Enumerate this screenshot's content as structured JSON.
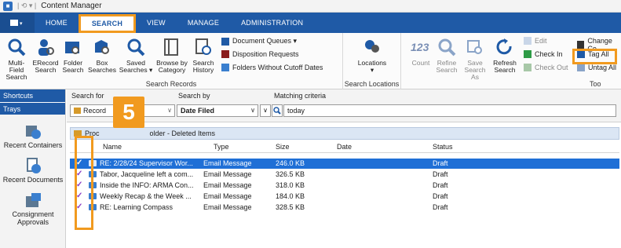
{
  "title": "Content Manager",
  "file_tab_label": "▾",
  "tabs": [
    "HOME",
    "SEARCH",
    "VIEW",
    "MANAGE",
    "ADMINISTRATION"
  ],
  "ribbon": {
    "search_records": {
      "buttons": [
        {
          "label": "Multi-Field Search",
          "icon": "magnifier-icon"
        },
        {
          "label": "ERecord Search",
          "icon": "person-search-icon"
        },
        {
          "label": "Folder Search",
          "icon": "folder-search-icon"
        },
        {
          "label": "Box Searches",
          "icon": "box-search-icon"
        },
        {
          "label": "Saved Searches ▾",
          "icon": "saved-search-icon"
        },
        {
          "label": "Browse by Category",
          "icon": "browse-icon"
        },
        {
          "label": "Search History",
          "icon": "history-icon"
        }
      ],
      "small": [
        "Document Queues ▾",
        "Disposition Requests",
        "Folders Without Cutoff Dates"
      ],
      "title": "Search Records"
    },
    "search_locations": {
      "button": "Locations",
      "dropdown": "▾",
      "title": "Search Locations"
    },
    "tools": {
      "buttons": [
        {
          "label": "Count",
          "icon": "count-123-icon"
        },
        {
          "label": "Refine Search",
          "icon": "refine-icon"
        },
        {
          "label": "Save Search As",
          "icon": "save-search-icon"
        },
        {
          "label": "Refresh Search",
          "icon": "refresh-icon"
        }
      ],
      "small_col1": [
        "Edit",
        "Check In",
        "Check Out"
      ],
      "small_col2": [
        "Change Co",
        "Tag All",
        "Untag All"
      ],
      "title": "Too"
    }
  },
  "left_panel": {
    "shortcuts": "Shortcuts",
    "trays": "Trays",
    "items": [
      "Recent Containers",
      "Recent Documents",
      "Consignment Approvals"
    ]
  },
  "search_bar": {
    "search_for_label": "Search for",
    "search_for_value": "Record",
    "search_by_label": "Search by",
    "search_by_value": "Date Filed",
    "criteria_label": "Matching criteria",
    "criteria_value": "today"
  },
  "results": {
    "title_prefix": "Proc",
    "title_suffix": "older - Deleted Items",
    "columns": [
      "Name",
      "Type",
      "Size",
      "Date",
      "Status"
    ],
    "rows": [
      {
        "name": "RE: 2/28/24 Supervisor Wor...",
        "type": "Email Message",
        "size": "246.0 KB",
        "date": "",
        "status": "Draft"
      },
      {
        "name": "Tabor, Jacqueline left a com...",
        "type": "Email Message",
        "size": "326.5 KB",
        "date": "",
        "status": "Draft"
      },
      {
        "name": "Inside the INFO: ARMA Con...",
        "type": "Email Message",
        "size": "318.0 KB",
        "date": "",
        "status": "Draft"
      },
      {
        "name": "Weekly Recap & the Week ...",
        "type": "Email Message",
        "size": "184.0 KB",
        "date": "",
        "status": "Draft"
      },
      {
        "name": "RE: Learning Compass",
        "type": "Email Message",
        "size": "328.5 KB",
        "date": "",
        "status": "Draft"
      }
    ],
    "check_mark": "✓"
  },
  "step_badge": "5",
  "colors": {
    "accent": "#1f5aa6",
    "highlight": "#f19a1f",
    "selection": "#1f6fd6",
    "tag": "#8a3cc2"
  }
}
